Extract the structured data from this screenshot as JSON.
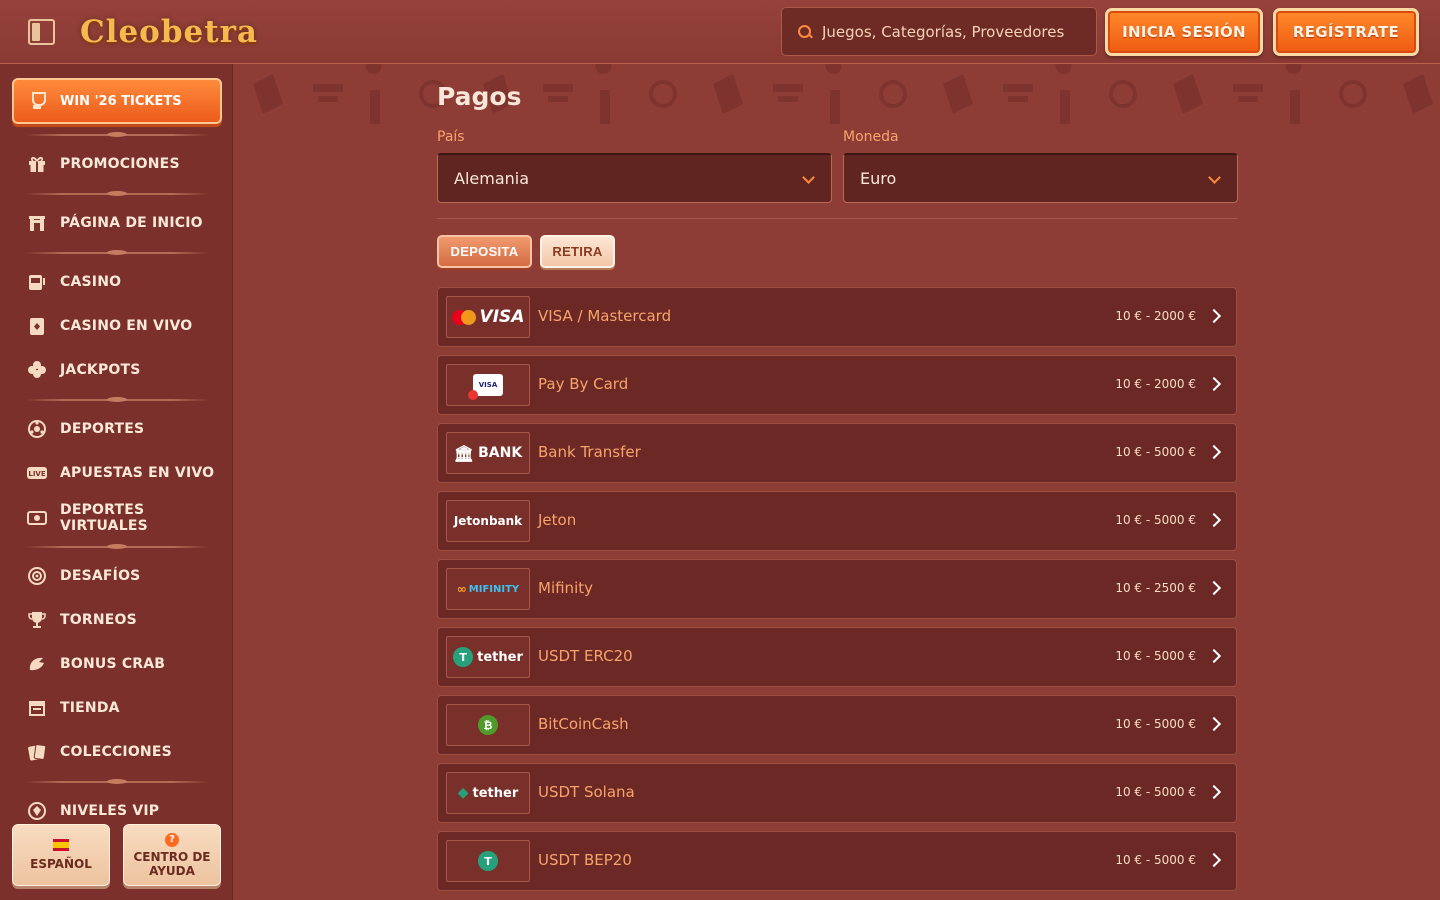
{
  "header": {
    "logo_text": "Cleobetra",
    "search_placeholder": "Juegos, Categorías, Proveedores",
    "login_label": "INICIA SESIÓN",
    "register_label": "REGÍSTRATE"
  },
  "sidebar": {
    "promo_label": "WIN '26 TICKETS",
    "items": [
      {
        "label": "PROMOCIONES",
        "icon": "gift-icon"
      },
      {
        "label": "PÁGINA DE INICIO",
        "icon": "home-icon"
      },
      {
        "label": "CASINO",
        "icon": "slot-machine-icon"
      },
      {
        "label": "CASINO EN VIVO",
        "icon": "live-cards-icon"
      },
      {
        "label": "JACKPOTS",
        "icon": "clover-icon"
      },
      {
        "label": "DEPORTES",
        "icon": "football-icon"
      },
      {
        "label": "APUESTAS EN VIVO",
        "icon": "live-badge-icon"
      },
      {
        "label": "DEPORTES VIRTUALES",
        "icon": "virtual-screen-icon"
      },
      {
        "label": "DESAFÍOS",
        "icon": "target-icon"
      },
      {
        "label": "TORNEOS",
        "icon": "trophy-icon"
      },
      {
        "label": "BONUS CRAB",
        "icon": "crab-claw-icon"
      },
      {
        "label": "TIENDA",
        "icon": "shop-icon"
      },
      {
        "label": "COLECCIONES",
        "icon": "cards-icon"
      },
      {
        "label": "NIVELES VIP",
        "icon": "vip-gem-icon"
      }
    ],
    "language_label": "ESPAÑOL",
    "help_label": "CENTRO DE AYUDA"
  },
  "main": {
    "title": "Pagos",
    "country_label": "País",
    "country_value": "Alemania",
    "currency_label": "Moneda",
    "currency_value": "Euro",
    "tabs": {
      "deposit": "DEPOSITA",
      "withdraw": "RETIRA"
    },
    "methods": [
      {
        "name": "VISA / Mastercard",
        "range": "10 € - 2000 €",
        "logo": "VISA"
      },
      {
        "name": "Pay By Card",
        "range": "10 € - 2000 €",
        "logo": "VISA"
      },
      {
        "name": "Bank Transfer",
        "range": "10 € - 5000 €",
        "logo": "BANK"
      },
      {
        "name": "Jeton",
        "range": "10 € - 5000 €",
        "logo": "Jetonbank"
      },
      {
        "name": "Mifinity",
        "range": "10 € - 2500 €",
        "logo": "MIFINITY"
      },
      {
        "name": "USDT ERC20",
        "range": "10 € - 5000 €",
        "logo": "tether"
      },
      {
        "name": "BitCoinCash",
        "range": "10 € - 5000 €",
        "logo": "bitcoin-cash"
      },
      {
        "name": "USDT Solana",
        "range": "10 € - 5000 €",
        "logo": "tether"
      },
      {
        "name": "USDT BEP20",
        "range": "10 € - 5000 €",
        "logo": "tether"
      }
    ]
  },
  "colors": {
    "background": "#8e3c36",
    "sidebar": "#7b302b",
    "accent_orange": "#ff7a2a",
    "label_orange": "#f6a46b"
  }
}
